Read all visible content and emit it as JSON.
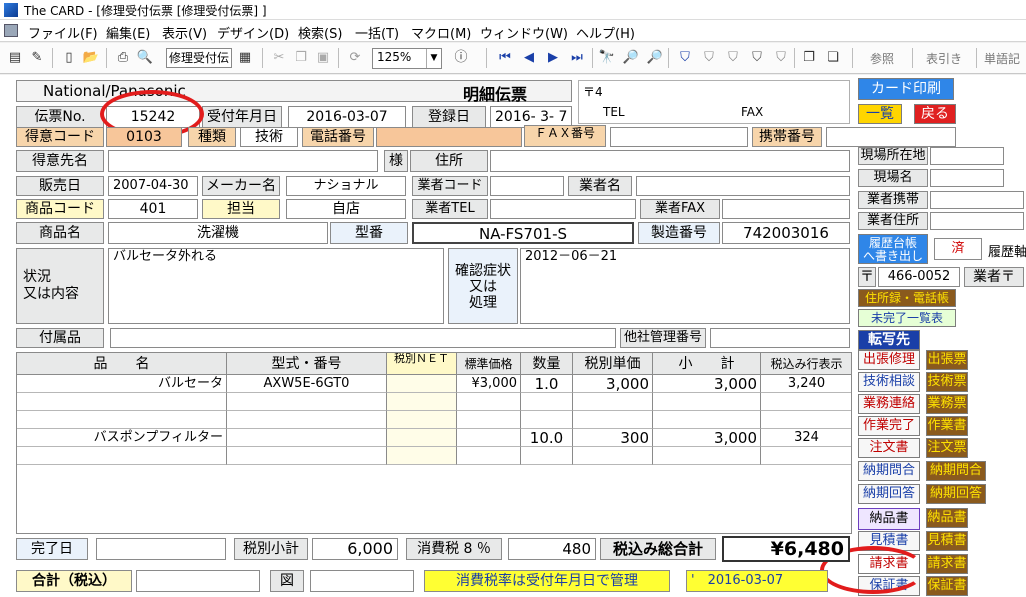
{
  "window": {
    "title": "The CARD - [修理受付伝票 [修理受付伝票] ]"
  },
  "menu": [
    "ファイル(F)",
    "編集(E)",
    "表示(V)",
    "デザイン(D)",
    "検索(S)",
    "一括(T)",
    "マクロ(M)",
    "ウィンドウ(W)",
    "ヘルプ(H)"
  ],
  "toolbar": {
    "form_selector": "修理受付伝",
    "zoom": "125%",
    "right_buttons": [
      "参照",
      "表引き",
      "単語記"
    ]
  },
  "header": {
    "maker": "National/Panasonic",
    "slip_title": "明細伝票",
    "postal_prefix": "〒4",
    "tel_label": "TEL",
    "fax_label": "FAX",
    "btn_card_print": "カード印刷",
    "btn_list": "一覧",
    "btn_back": "戻る"
  },
  "slip": {
    "slip_no_label": "伝票No.",
    "slip_no": "15242",
    "received_label": "受付年月日",
    "received_date": "2016-03-07",
    "registered_label": "登録日",
    "registered_date": "2016- 3- 7"
  },
  "customer": {
    "code_label": "得意コード",
    "code_value": "0103",
    "type_label": "種類",
    "type_value": "技術",
    "phone_label": "電話番号",
    "fax_label": "ＦＡＸ番号",
    "mobile_label": "携帯番号",
    "name_label": "得意先名",
    "honorific": "様",
    "address_label": "住所"
  },
  "sale": {
    "sale_date_label": "販売日",
    "sale_date": "2007-04-30",
    "maker_label": "メーカー名",
    "maker_value": "ナショナル",
    "vendor_code_label": "業者コード",
    "vendor_name_label": "業者名",
    "product_code_label": "商品コード",
    "product_code": "401",
    "staff_label": "担当",
    "staff_value": "自店",
    "vendor_tel_label": "業者TEL",
    "vendor_fax_label": "業者FAX",
    "product_name_label": "商品名",
    "product_name": "洗濯機",
    "model_label": "型番",
    "model_value": "NA-FS701-S",
    "serial_label": "製造番号",
    "serial_value": "742003016"
  },
  "status": {
    "label_line1": "状況",
    "label_line2": "又は内容",
    "content": "バルセータ外れる",
    "confirm_label_line1": "確認症状",
    "confirm_label_line2": "又は",
    "confirm_label_line3": "処理",
    "confirm_content": "2012－06－21"
  },
  "accessories": {
    "label": "付属品",
    "other_mgmt_label": "他社管理番号"
  },
  "side": {
    "site_address_label": "現場所在地",
    "site_name_label": "現場名",
    "vendor_mobile_label": "業者携帯",
    "vendor_address_label": "業者住所",
    "history_btn_line1": "履歴台帳",
    "history_btn_line2": "へ書き出し",
    "done_label": "済",
    "history_label": "履歴軸",
    "postal_mark": "〒",
    "postal_code": "466-0052",
    "vendor_postal_label": "業者〒",
    "address_book_btn": "住所録・電話帳",
    "incomplete_btn": "未完了一覧表",
    "transfer_header": "転写先"
  },
  "transfer_buttons": [
    {
      "left": "出張修理",
      "right": "出張票",
      "left_color": "#c00000"
    },
    {
      "left": "技術相談",
      "right": "技術票",
      "left_color": "#1a3fa8"
    },
    {
      "left": "業務連絡",
      "right": "業務票",
      "left_color": "#c00000"
    },
    {
      "left": "作業完了",
      "right": "作業書",
      "left_color": "#c00000"
    },
    {
      "left": "注文書",
      "right": "注文票",
      "left_color": "#c00000"
    },
    {
      "left": "納期問合",
      "right": "納期問合",
      "left_color": "#1a3fa8"
    },
    {
      "left": "納期回答",
      "right": "納期回答",
      "left_color": "#1a3fa8"
    },
    {
      "left": "納品書",
      "right": "納品書",
      "left_color": "#000000"
    },
    {
      "left": "見積書",
      "right": "見積書",
      "left_color": "#1a3fa8"
    },
    {
      "left": "請求書",
      "right": "請求書",
      "left_color": "#c00000"
    },
    {
      "left": "保証書",
      "right": "保証書",
      "left_color": "#1a3fa8"
    }
  ],
  "table": {
    "headers": [
      "品　　名",
      "型式・番号",
      "税別ＮＥＴ",
      "標準価格",
      "数量",
      "税別単価",
      "小　　計",
      "税込み行表示"
    ],
    "rows": [
      [
        "バルセータ",
        "AXW5E-6GT0",
        "",
        "¥3,000",
        "1.0",
        "3,000",
        "3,000",
        "3,240"
      ],
      [
        "",
        "",
        "",
        "",
        "",
        "",
        "",
        ""
      ],
      [
        "",
        "",
        "",
        "",
        "",
        "",
        "",
        ""
      ],
      [
        "バスポンプフィルター",
        "",
        "",
        "",
        "10.0",
        "300",
        "3,000",
        "324"
      ],
      [
        "",
        "",
        "",
        "",
        "",
        "",
        "",
        ""
      ]
    ]
  },
  "totals": {
    "completion_label": "完了日",
    "subtotal_label": "税別小計",
    "subtotal_value": "6,000",
    "tax_label": "消費税 8 ％",
    "tax_value": "480",
    "grand_label": "税込み総合計",
    "grand_value": "¥6,480",
    "incl_tax_label": "合計（税込）",
    "figure_label": "図",
    "tax_note": "消費税率は受付年月日で管理",
    "tax_date": "'　2016-03-07"
  },
  "colors": {
    "accent_blue": "#1f6fd6",
    "annotation_red": "#e21c1c",
    "label_pink": "#f7d5ab",
    "note_yellow": "#ffff33"
  }
}
